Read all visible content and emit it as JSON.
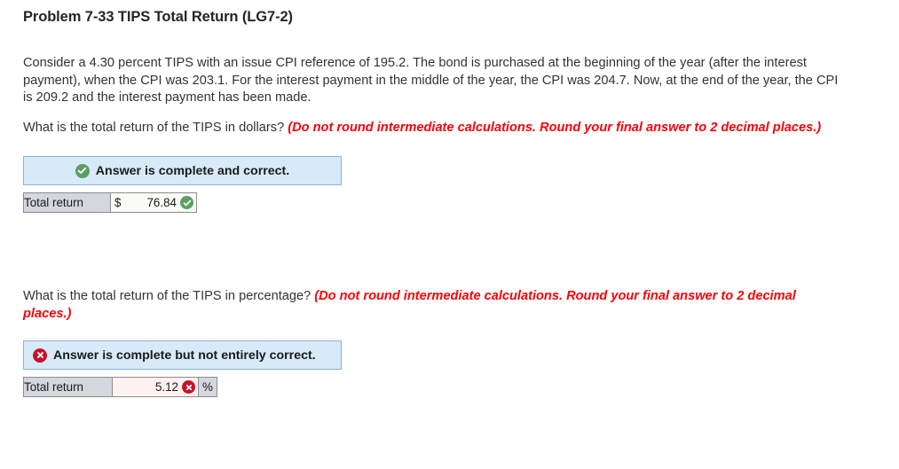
{
  "title": "Problem 7-33 TIPS Total Return (LG7-2)",
  "scenario": "Consider a 4.30 percent TIPS with an issue CPI reference of 195.2. The bond is purchased at the beginning of the year (after the interest payment), when the CPI was 203.1. For the interest payment in the middle of the year, the CPI was 204.7. Now, at the end of the year, the CPI is 209.2 and the interest payment has been made.",
  "questions": [
    {
      "prompt": "What is the total return of the TIPS in dollars? ",
      "hint": "(Do not round intermediate calculations. Round your final answer to 2 decimal places.)"
    },
    {
      "prompt": "What is the total return of the TIPS in percentage? ",
      "hint": "(Do not round intermediate calculations. Round your final answer to 2 decimal places.)"
    }
  ],
  "answers": [
    {
      "status_text": "Answer is complete and correct.",
      "status_icon": "check-circle-icon",
      "status_color": "#5a9e63",
      "row_label": "Total return",
      "currency": "$",
      "value": "76.84",
      "unit": "",
      "mark_icon": "check-circle-icon",
      "mark_color": "#5a9e63"
    },
    {
      "status_text": "Answer is complete but not entirely correct.",
      "status_icon": "x-circle-icon",
      "status_color": "#c8112a",
      "row_label": "Total return",
      "currency": "",
      "value": "5.12",
      "unit": "%",
      "mark_icon": "x-circle-icon",
      "mark_color": "#c8112a"
    }
  ],
  "colors": {
    "banner_background": "#d7eaf7",
    "banner_border": "#8bb5d4",
    "hint_red": "#fb0007",
    "label_cell": "#d4d7dd",
    "input_cell": "#fafaf7",
    "input_cell_wrong": "#fdf2f0"
  }
}
